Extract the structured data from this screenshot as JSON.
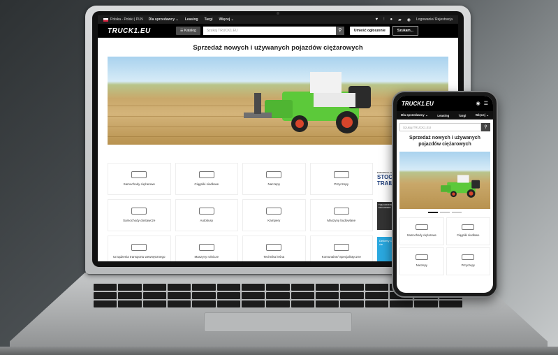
{
  "topbar": {
    "language": "Polska - Polski | PLN",
    "nav": [
      "Dla sprzedawcy ⌄",
      "Leasing",
      "Targi",
      "Więcej ⌄"
    ],
    "login": "Logowanie/ Rejestracja",
    "icons": [
      "heart-icon",
      "chart-icon",
      "bell-icon",
      "chat-icon",
      "user-icon"
    ]
  },
  "header": {
    "logo": "TRUCK1.EU",
    "catalog_label": "☰ Katalog",
    "search_placeholder": "Szukaj TRUCK1.EU",
    "post_ad_label": "Umieść ogłoszenie",
    "searching_label": "Szukam..."
  },
  "page": {
    "title": "Sprzedaż nowych i używanych pojazdów ciężarowych"
  },
  "categories": [
    {
      "label": "Samochody ciężarowe"
    },
    {
      "label": "Ciągniki siodłowe"
    },
    {
      "label": "Naczepy"
    },
    {
      "label": "Przyczepy"
    },
    {
      "label": "Samochody dostawcze"
    },
    {
      "label": "Autobusy"
    },
    {
      "label": "Kampery"
    },
    {
      "label": "Maszyny budowlane"
    },
    {
      "label": "Urządzenia transportu wewnętrznego"
    },
    {
      "label": "Maszyny rolnicze"
    },
    {
      "label": "Technika leśna"
    },
    {
      "label": "Komunalne/ Specjalistyczne"
    }
  ],
  "ads": {
    "stock_title": "STOCK",
    "stock_sub": "TRAILER",
    "stock_top": "EUROPE'S LARGEST",
    "dark_ad": "THE CONSTRUCTION MACHINERY DEALER",
    "blue_ad": "Delivery Customs cle"
  },
  "phone": {
    "logo": "TRUCK1.EU",
    "nav": [
      "Dla sprzedawcy ⌄",
      "Leasing",
      "Targi",
      "Więcej ⌄"
    ],
    "search_placeholder": "Szukaj TRUCK1.EU",
    "title": "Sprzedaż nowych i używanych pojazdów ciężarowych",
    "categories": [
      {
        "label": "Samochody ciężarowe"
      },
      {
        "label": "Ciągniki siodłowe"
      },
      {
        "label": "Naczepy"
      },
      {
        "label": "Przyczepy"
      }
    ]
  }
}
